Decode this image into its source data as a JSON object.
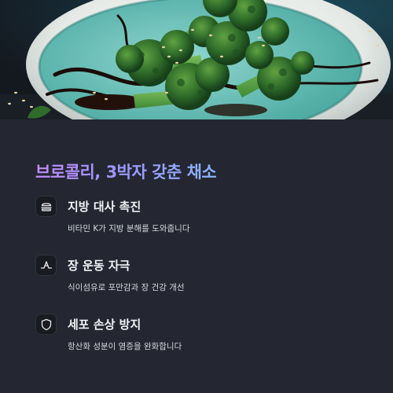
{
  "title": "브로콜리, 3박자 갖춘 채소",
  "benefits": [
    {
      "icon": "burger-icon",
      "title": "지방 대사 촉진",
      "desc": "비타민 K가 지방 분해를 도와줍니다"
    },
    {
      "icon": "intestine-icon",
      "title": "장 운동 자극",
      "desc": "식이섬유로 포만감과 장 건강 개선"
    },
    {
      "icon": "shield-icon",
      "title": "세포 손상 방지",
      "desc": "항산화 성분이 염증을 완화합니다"
    }
  ],
  "colors": {
    "background": "#242731",
    "title_gradient_start": "#c38cff",
    "title_gradient_end": "#8ab4ff",
    "icon_box": "#191b21",
    "text_primary": "#f2f3f6",
    "text_secondary": "#d5d8de"
  }
}
